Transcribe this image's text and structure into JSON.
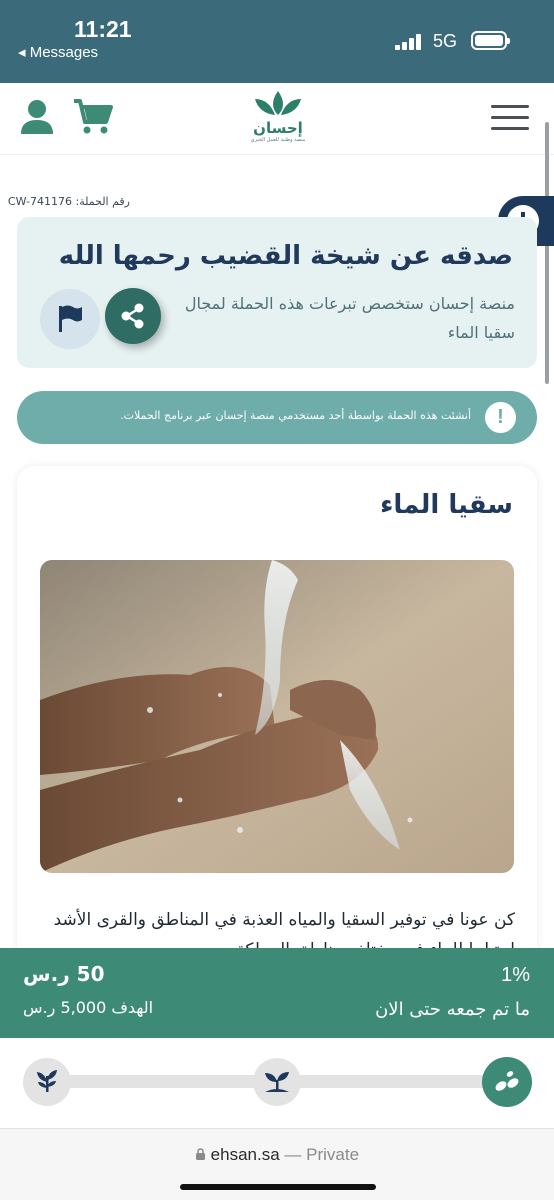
{
  "status_bar": {
    "time": "11:21",
    "back_label": "◂ Messages",
    "network": "5G"
  },
  "header": {
    "logo_text": "إحسان",
    "logo_subtitle": "منصة وطنية للعمل الخيري",
    "icons": [
      "user-icon",
      "cart-icon",
      "menu-icon"
    ]
  },
  "campaign": {
    "id_label": "رقم الحملة:",
    "id_value": "CW-741176",
    "title": "صدقه عن شيخة القضيب رحمها الله",
    "description": "منصة إحسان ستخصص تبرعات هذه الحملة لمجال سقيا الماء"
  },
  "notice": {
    "text": "أنشئت هذه الحملة بواسطة أحد مستخدمي منصة إحسان عبر برنامج الحملات."
  },
  "content": {
    "section_title": "سقيا الماء",
    "line1": "كن عونا في توفير السقيا والمياه العذبة في المناطق والقرى الأشد",
    "line2": "احتياجا للماء في مختلف مناطق المملكة"
  },
  "progress": {
    "raised_amount": "50 ر.س",
    "goal_label": "الهدف 5,000 ر.س",
    "percent_text": "1%",
    "percent_value": 1,
    "raised_label": "ما تم جمعه حتى الان"
  },
  "stages": [
    "seedling-icon",
    "sprout-icon",
    "seeds-icon"
  ],
  "browser": {
    "domain": "ehsan.sa",
    "mode": "— Private"
  },
  "colors": {
    "status_bar": "#3b6b7a",
    "primary_green": "#3d8b76",
    "navy": "#1d3a5c",
    "card_bg": "#e6f1f1",
    "notice_bg": "#6fadaa"
  }
}
